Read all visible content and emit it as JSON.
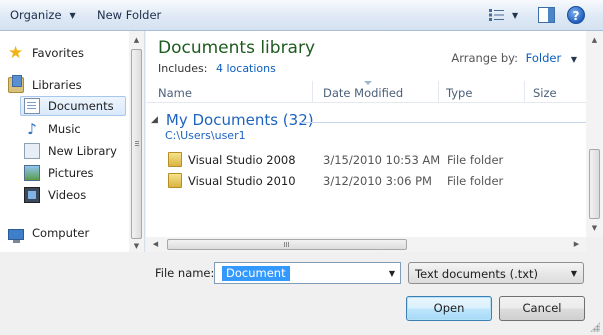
{
  "toolbar": {
    "organize": "Organize",
    "new_folder": "New Folder",
    "help": "?",
    "views_icon": "views-list-icon",
    "preview_icon": "preview-pane-icon"
  },
  "nav": {
    "favorites": "Favorites",
    "libraries": "Libraries",
    "items": [
      {
        "label": "Documents",
        "icon": "documents-icon",
        "selected": true
      },
      {
        "label": "Music",
        "icon": "music-note-icon"
      },
      {
        "label": "New Library",
        "icon": "library-icon"
      },
      {
        "label": "Pictures",
        "icon": "pictures-icon"
      },
      {
        "label": "Videos",
        "icon": "videos-icon"
      }
    ],
    "computer": "Computer"
  },
  "main": {
    "title": "Documents library",
    "includes_label": "Includes:",
    "includes_link": "4 locations",
    "arrange_label": "Arrange by:",
    "arrange_value": "Folder",
    "columns": [
      "Name",
      "Date Modified",
      "Type",
      "Size"
    ],
    "group": {
      "title": "My Documents (32)",
      "path": "C:\\Users\\user1"
    },
    "rows": [
      {
        "name": "Visual Studio 2008",
        "date": "3/15/2010 10:53 AM",
        "type": "File folder"
      },
      {
        "name": "Visual Studio 2010",
        "date": "3/12/2010 3:06 PM",
        "type": "File folder"
      }
    ]
  },
  "footer": {
    "file_name_label": "File name:",
    "file_name_value": "Document",
    "file_type": "Text documents (.txt)",
    "open": "Open",
    "cancel": "Cancel"
  },
  "colors": {
    "title_green": "#1e5b1e",
    "link_blue": "#0b5fbf",
    "selection": "#3399ff"
  }
}
